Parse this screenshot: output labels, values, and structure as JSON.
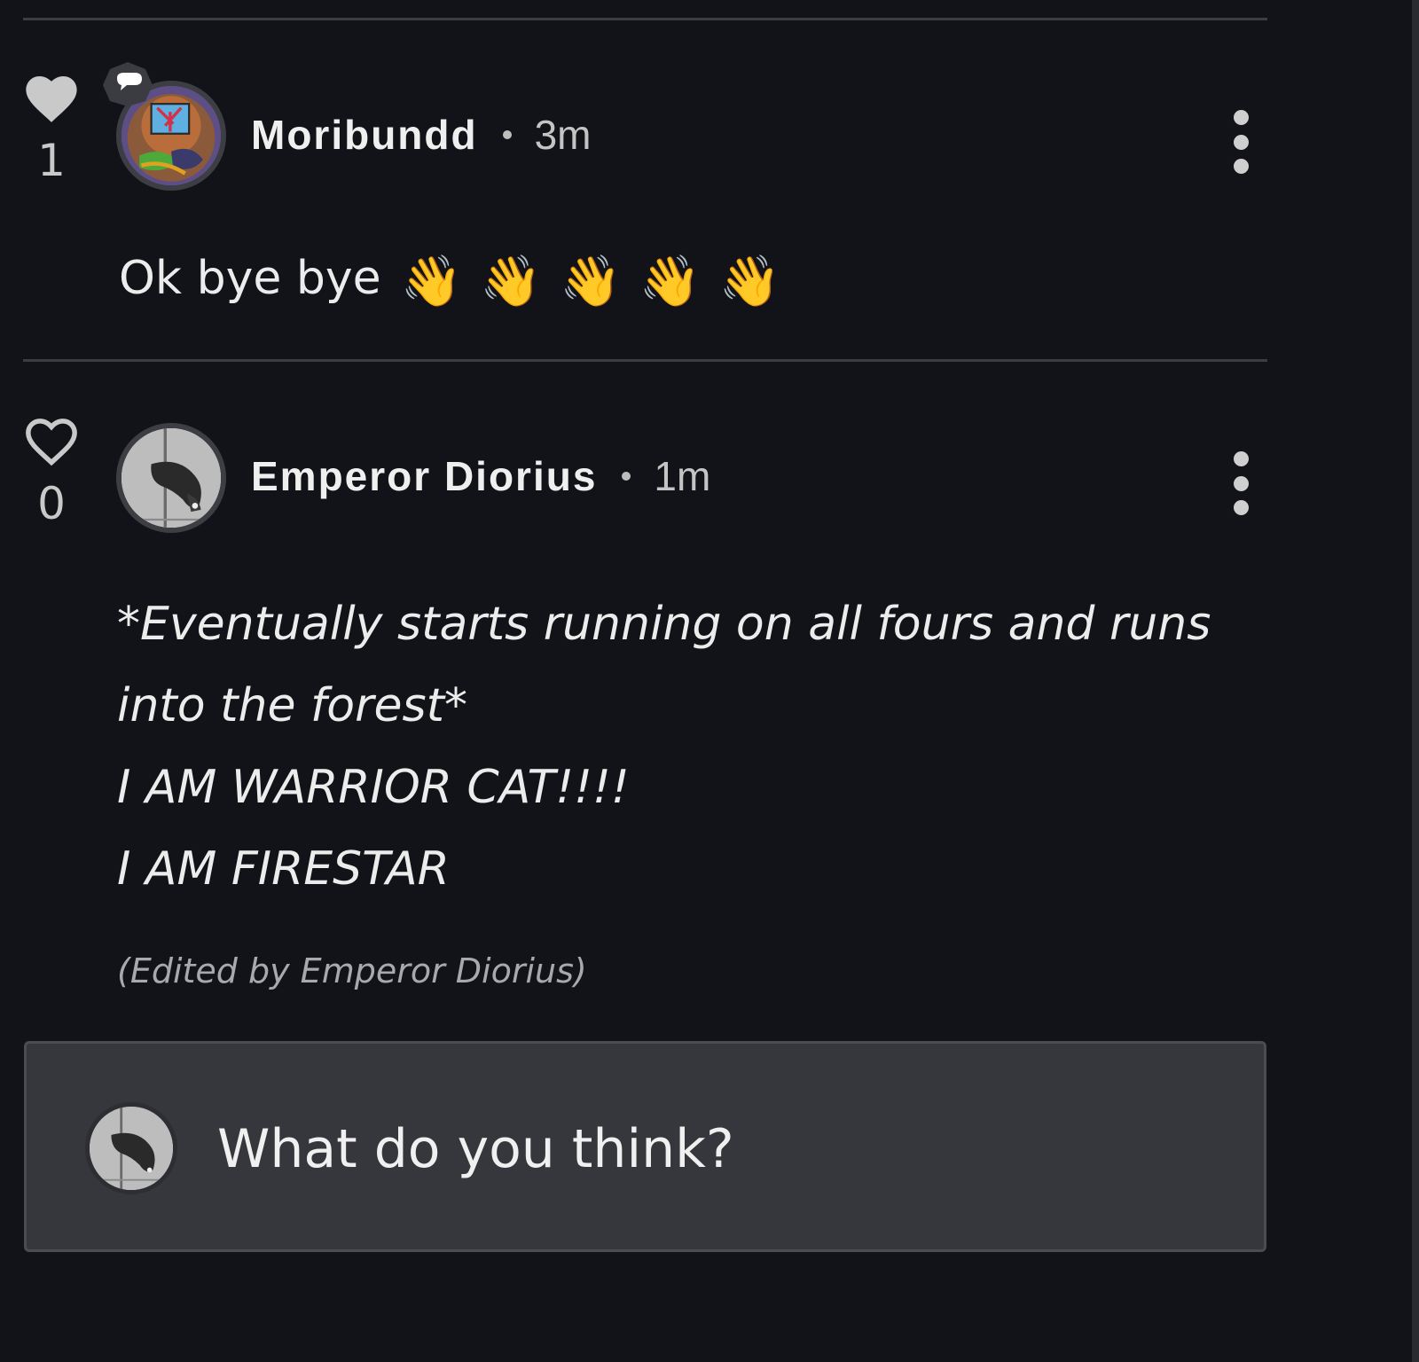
{
  "comments": [
    {
      "username": "Moribundd",
      "time": "3m",
      "likes": "1",
      "liked": true,
      "text": "Ok bye bye",
      "emojis": [
        "👋",
        "👋",
        "👋",
        "👋",
        "👋"
      ],
      "has_chat_badge": true
    },
    {
      "username": "Emperor Diorius",
      "time": "1m",
      "likes": "0",
      "liked": false,
      "lines": [
        "*Eventually starts running on all fours and runs",
        "into the forest*",
        "I AM WARRIOR CAT!!!!",
        "I AM FIRESTAR"
      ],
      "edited_note": "(Edited by Emperor Diorius)"
    }
  ],
  "composer": {
    "placeholder": "What do you think?"
  },
  "colors": {
    "background": "#121318",
    "divider": "#3c3d42",
    "composer_bg": "#36373c",
    "text": "#ececec",
    "muted": "#a9a9ad"
  },
  "icons": [
    "heart-filled-icon",
    "heart-outline-icon",
    "chat-bubble-badge-icon",
    "more-vertical-icon",
    "wave-emoji"
  ]
}
